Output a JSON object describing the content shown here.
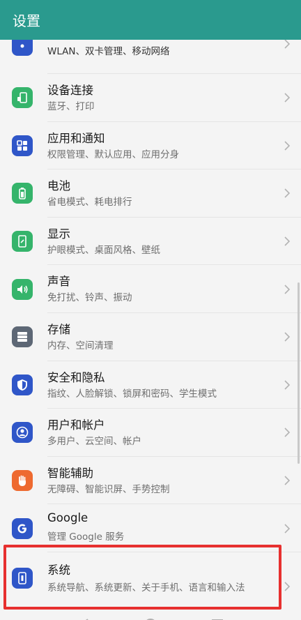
{
  "app_bar": {
    "title": "设置"
  },
  "items": [
    {
      "id": "network",
      "title": "",
      "subtitle": "WLAN、双卡管理、移动网络",
      "icon": "wifi-icon",
      "color": "#2f56c8"
    },
    {
      "id": "device-connection",
      "title": "设备连接",
      "subtitle": "蓝牙、打印",
      "icon": "device-connect-icon",
      "color": "#35b46b"
    },
    {
      "id": "apps",
      "title": "应用和通知",
      "subtitle": "权限管理、默认应用、应用分身",
      "icon": "apps-grid-icon",
      "color": "#2f56c8"
    },
    {
      "id": "battery",
      "title": "电池",
      "subtitle": "省电模式、耗电排行",
      "icon": "battery-icon",
      "color": "#35b46b"
    },
    {
      "id": "display",
      "title": "显示",
      "subtitle": "护眼模式、桌面风格、壁纸",
      "icon": "display-icon",
      "color": "#35b46b"
    },
    {
      "id": "sound",
      "title": "声音",
      "subtitle": "免打扰、铃声、振动",
      "icon": "speaker-icon",
      "color": "#35b46b"
    },
    {
      "id": "storage",
      "title": "存储",
      "subtitle": "内存、空间清理",
      "icon": "storage-icon",
      "color": "#5d6775"
    },
    {
      "id": "security",
      "title": "安全和隐私",
      "subtitle": "指纹、人脸解锁、锁屏和密码、学生模式",
      "icon": "shield-icon",
      "color": "#2f56c8"
    },
    {
      "id": "accounts",
      "title": "用户和帐户",
      "subtitle": "多用户、云空间、帐户",
      "icon": "user-icon",
      "color": "#2f56c8"
    },
    {
      "id": "assist",
      "title": "智能辅助",
      "subtitle": "无障碍、智能识屏、手势控制",
      "icon": "hand-icon",
      "color": "#ee6a30"
    },
    {
      "id": "google",
      "title": "Google",
      "subtitle": "管理 Google 服务",
      "icon": "google-icon",
      "color": "#2f56c8"
    },
    {
      "id": "system",
      "title": "系统",
      "subtitle": "系统导航、系统更新、关于手机、语言和输入法",
      "icon": "phone-icon",
      "color": "#2f56c8"
    }
  ],
  "colors": {
    "app_bar_bg": "#2a9a8e",
    "highlight_border": "#e7302f"
  }
}
